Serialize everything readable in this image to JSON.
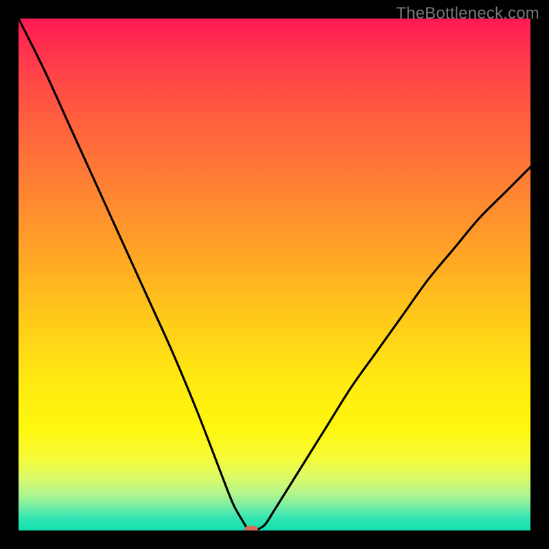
{
  "watermark": "TheBottleneck.com",
  "chart_data": {
    "type": "line",
    "title": "",
    "xlabel": "",
    "ylabel": "",
    "xlim": [
      0,
      100
    ],
    "ylim": [
      0,
      100
    ],
    "grid": false,
    "legend": false,
    "series": [
      {
        "name": "curve",
        "x": [
          0,
          5,
          10,
          15,
          20,
          25,
          30,
          35,
          40,
          42,
          44,
          45,
          46,
          48,
          50,
          55,
          60,
          65,
          70,
          75,
          80,
          85,
          90,
          95,
          100
        ],
        "y": [
          100,
          90,
          79,
          68,
          57,
          46,
          35,
          23,
          10,
          5,
          1.5,
          0,
          0,
          1,
          4,
          12,
          20,
          28,
          35,
          42,
          49,
          55,
          61,
          66,
          71
        ]
      }
    ],
    "marker": {
      "x": 45.5,
      "y": 0
    },
    "background_gradient": {
      "top": "#ff1a53",
      "mid": "#ffe812",
      "bottom": "#11e0af"
    }
  }
}
